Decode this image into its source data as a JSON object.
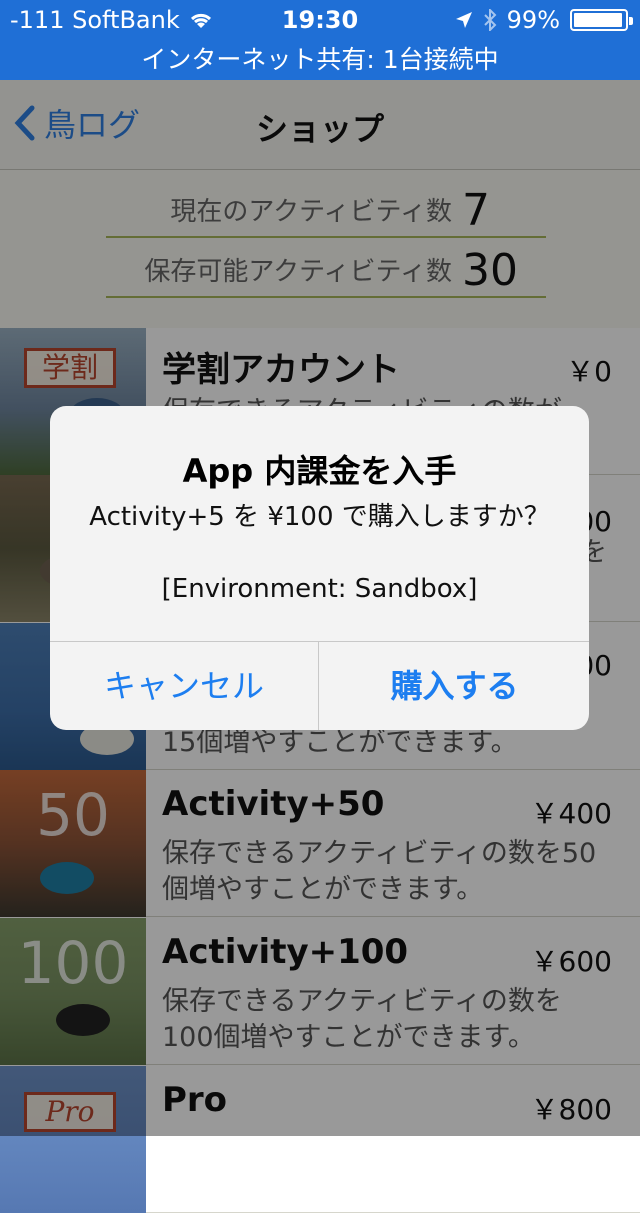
{
  "status": {
    "carrier": "-111 SoftBank",
    "time": "19:30",
    "battery": "99%",
    "hotspot": "インターネット共有: 1台接続中"
  },
  "nav": {
    "back_label": "鳥ログ",
    "title": "ショップ"
  },
  "counts": {
    "current_label": "現在のアクティビティ数",
    "current_value": "7",
    "storable_label": "保存可能アクティビティ数",
    "storable_value": "30"
  },
  "products": [
    {
      "title": "学割アカウント",
      "price": "￥0",
      "desc": "保存できるアクティビティの数が",
      "thumb_text": "学割"
    },
    {
      "title": "",
      "price": "00",
      "desc": "を",
      "thumb_text": ""
    },
    {
      "title": "",
      "price": "00",
      "desc": "15個増やすことができます。",
      "thumb_text": ""
    },
    {
      "title": "Activity+50",
      "price": "￥400",
      "desc": "保存できるアクティビティの数を50個増やすことができます。",
      "thumb_text": "50"
    },
    {
      "title": "Activity+100",
      "price": "￥600",
      "desc": "保存できるアクティビティの数を100個増やすことができます。",
      "thumb_text": "100"
    },
    {
      "title": "Pro",
      "price": "￥800",
      "desc": "",
      "thumb_text": "Pro"
    }
  ],
  "alert": {
    "title": "App 内課金を入手",
    "message": "Activity+5 を ¥100 で購入しますか？",
    "environment": "[Environment: Sandbox]",
    "cancel": "キャンセル",
    "buy": "購入する"
  },
  "colors": {
    "status_bar": "#1f6fd6",
    "accent": "#1d7ef0",
    "divider": "#a7b65a"
  }
}
